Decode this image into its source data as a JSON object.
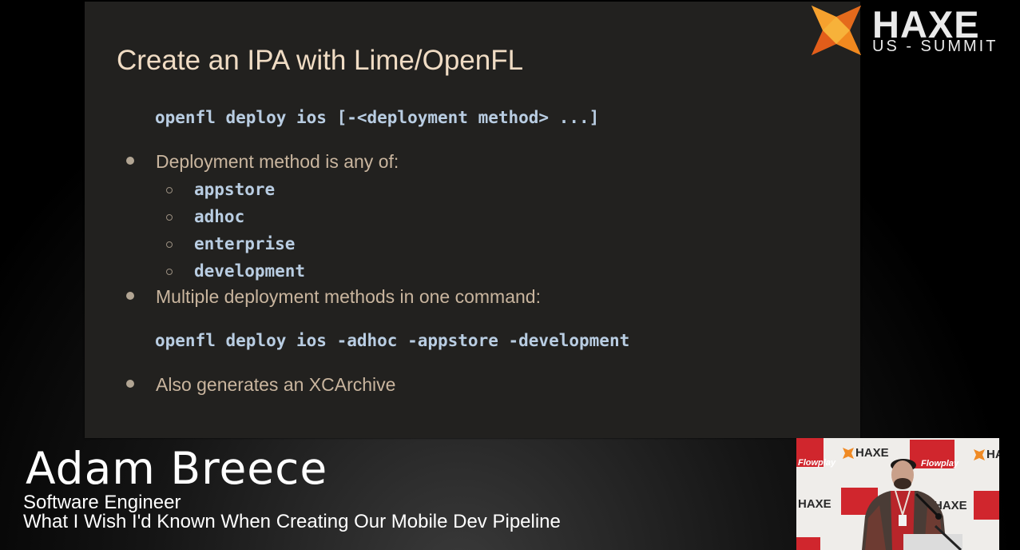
{
  "slide": {
    "title": "Create an IPA with Lime/OpenFL",
    "command_syntax": "openfl deploy ios [-<deployment method> ...]",
    "bullets": [
      {
        "text": "Deployment method is any of:",
        "sub_items": [
          "appstore",
          "adhoc",
          "enterprise",
          "development"
        ]
      },
      {
        "text": "Multiple deployment methods in one command:",
        "code": "openfl deploy ios -adhoc -appstore -development"
      },
      {
        "text": "Also generates an XCArchive"
      }
    ]
  },
  "logo": {
    "word": "HAXE",
    "sub": "US - SUMMIT",
    "icon": "haxe-logo-icon",
    "accent_color": "#f47a1f"
  },
  "lower_third": {
    "name": "Adam Breece",
    "role": "Software Engineer",
    "talk_title": "What I Wish I'd Known When Creating Our Mobile Dev Pipeline"
  },
  "camera": {
    "backdrop_haxe": "HAXE",
    "backdrop_flowplay": "Flowplay",
    "accent_color": "#d0262d"
  },
  "colors": {
    "slide_background": "#22211f",
    "title": "#f0dcc4",
    "body_text": "#c9b59e",
    "code": "#b9cde2"
  }
}
